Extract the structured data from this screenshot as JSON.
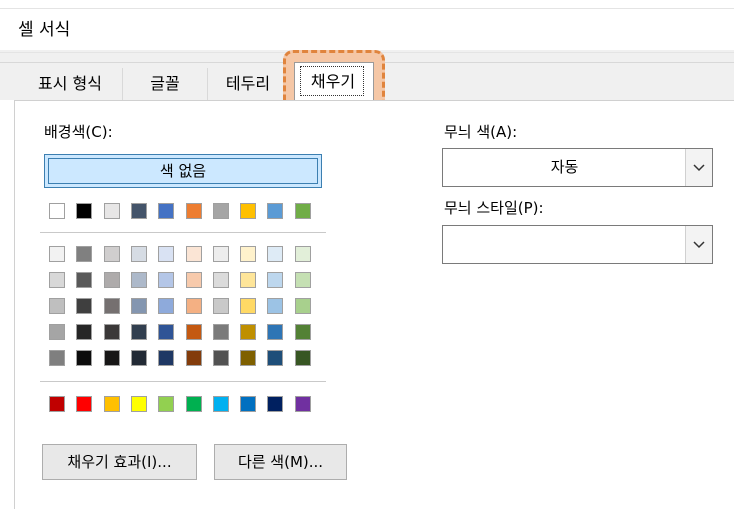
{
  "window": {
    "title": "셀 서식"
  },
  "tabs": [
    {
      "label": "표시 형식"
    },
    {
      "label": "글꼴"
    },
    {
      "label": "테두리"
    },
    {
      "label": "채우기",
      "active": true
    }
  ],
  "fill": {
    "background_label": "배경색(C):",
    "no_color_label": "색 없음",
    "theme_top_row": [
      "#ffffff",
      "#000000",
      "#e7e6e6",
      "#44546a",
      "#4472c4",
      "#ed7d31",
      "#a5a5a5",
      "#ffc000",
      "#5b9bd5",
      "#70ad47"
    ],
    "theme_shades": [
      [
        "#f2f2f2",
        "#808080",
        "#d0cece",
        "#d6dce4",
        "#d9e2f3",
        "#fbe5d5",
        "#ededed",
        "#fff2cc",
        "#deebf6",
        "#e2efd9"
      ],
      [
        "#d8d8d8",
        "#595959",
        "#aeabab",
        "#adb9ca",
        "#b4c6e7",
        "#f7caac",
        "#dbdbdb",
        "#fee599",
        "#bdd7ee",
        "#c5e0b3"
      ],
      [
        "#bfbfbf",
        "#3f3f3f",
        "#757070",
        "#8496b0",
        "#8eaadb",
        "#f4b083",
        "#c9c9c9",
        "#ffd965",
        "#9cc3e5",
        "#a8d08d"
      ],
      [
        "#a5a5a5",
        "#262626",
        "#3a3838",
        "#323f4f",
        "#2f5496",
        "#c45911",
        "#7b7b7b",
        "#bf8f00",
        "#2e75b5",
        "#538135"
      ],
      [
        "#7f7f7f",
        "#0c0c0c",
        "#171616",
        "#222a35",
        "#1f3864",
        "#833c0b",
        "#525252",
        "#7f6000",
        "#1e4e79",
        "#375623"
      ]
    ],
    "standard_colors": [
      "#c00000",
      "#ff0000",
      "#ffc000",
      "#ffff00",
      "#92d050",
      "#00b050",
      "#00b0f0",
      "#0070c0",
      "#002060",
      "#7030a0"
    ],
    "fill_effects_button": "채우기 효과(I)...",
    "more_colors_button": "다른 색(M)..."
  },
  "pattern": {
    "color_label": "무늬 색(A):",
    "color_value": "자동",
    "style_label": "무늬 스타일(P):",
    "style_value": ""
  }
}
